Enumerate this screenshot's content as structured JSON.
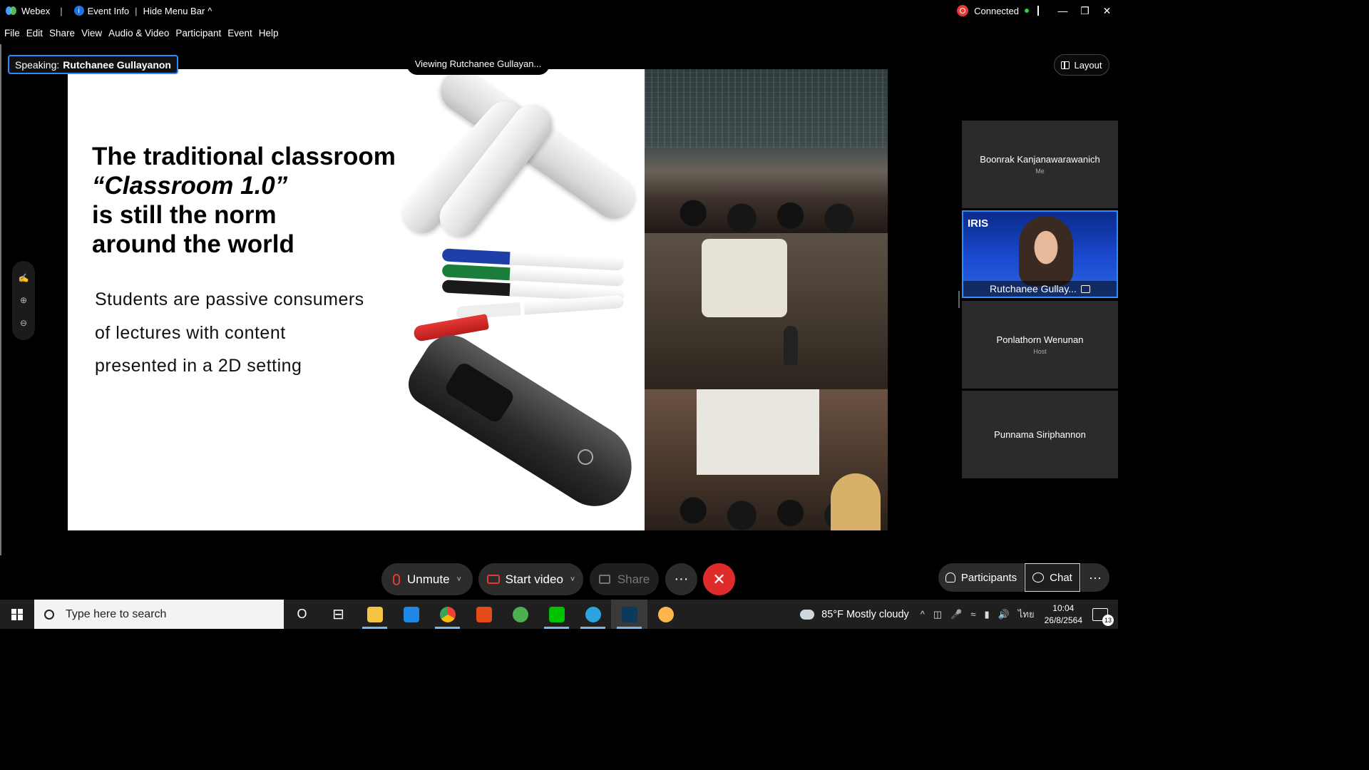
{
  "titlebar": {
    "app_name": "Webex",
    "separator": "|",
    "event_info": "Event Info",
    "hide_menu": "Hide Menu Bar",
    "hide_menu_caret": "^",
    "status": "Connected",
    "minimize": "—",
    "restore": "❐",
    "close": "✕"
  },
  "menu": [
    "File",
    "Edit",
    "Share",
    "View",
    "Audio & Video",
    "Participant",
    "Event",
    "Help"
  ],
  "stage": {
    "speaking_prefix": "Speaking:",
    "speaking_name": "Rutchanee Gullayanon",
    "viewing": "Viewing Rutchanee Gullayan...",
    "layout": "Layout"
  },
  "slide": {
    "title_line1": "The traditional classroom",
    "title_line2": "“Classroom 1.0”",
    "title_line3": "is still the norm",
    "title_line4": "around the world",
    "body_line1": "Students are passive consumers",
    "body_line2": "of lectures with content",
    "body_line3": "presented in a 2D setting"
  },
  "annotation_tools": {
    "annotate": "✍",
    "zoom_in": "⊕",
    "zoom_out": "⊖"
  },
  "participants": [
    {
      "name": "Boonrak Kanjanawarawanich",
      "role": "Me"
    },
    {
      "name": "Rutchanee Gullay...",
      "role": "",
      "brand": "IRIS"
    },
    {
      "name": "Ponlathorn Wenunan",
      "role": "Host"
    },
    {
      "name": "Punnama Siriphannon",
      "role": ""
    }
  ],
  "controls": {
    "unmute": "Unmute",
    "start_video": "Start video",
    "share": "Share",
    "more": "···",
    "leave": "✕",
    "caret": "˅"
  },
  "panels": {
    "participants": "Participants",
    "chat": "Chat",
    "more": "···"
  },
  "taskbar": {
    "search_placeholder": "Type here to search",
    "weather": "85°F  Mostly cloudy",
    "language": "ไทย",
    "time": "10:04",
    "date": "26/8/2564",
    "notification_count": "13",
    "cortana": "O",
    "task_view": "⊟"
  },
  "colors": {
    "accent_blue": "#2f8cff",
    "leave_red": "#e02b2b",
    "mute_red": "#e53935",
    "status_green": "#2ecc40"
  }
}
